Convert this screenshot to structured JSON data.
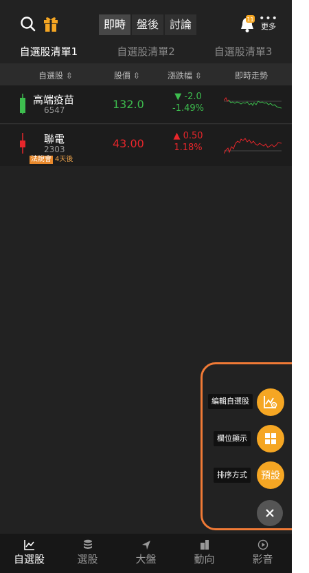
{
  "header": {
    "segments": [
      "即時",
      "盤後",
      "討論"
    ],
    "active_segment": 0,
    "notification_badge": "11",
    "more_label": "更多"
  },
  "list_tabs": [
    "自選股清單1",
    "自選股清單2",
    "自選股清單3"
  ],
  "columns": {
    "stock": "自選股",
    "price": "股價",
    "change": "漲跌幅",
    "trend": "即時走勢"
  },
  "stocks": [
    {
      "name": "高端疫苗",
      "code": "6547",
      "price": "132.0",
      "change": "▼ -2.0",
      "change_pct": "-1.49%",
      "direction": "down",
      "color": "#3dbd4e"
    },
    {
      "name": "聯電",
      "code": "2303",
      "price": "43.00",
      "change": "▲ 0.50",
      "change_pct": "1.18%",
      "direction": "up",
      "color": "#e8262b",
      "event_badge": "法說會",
      "event_time": "4天後"
    }
  ],
  "fab_menu": {
    "edit_label": "編輯自選股",
    "fields_label": "欄位顯示",
    "sort_label": "排序方式",
    "sort_button": "預設",
    "accent": "#f5a623",
    "outline": "#f07a36"
  },
  "bottom_nav": [
    {
      "label": "自選股",
      "icon": "chart-line-icon"
    },
    {
      "label": "選股",
      "icon": "database-icon"
    },
    {
      "label": "大盤",
      "icon": "navigation-arrow-icon"
    },
    {
      "label": "動向",
      "icon": "building-icon"
    },
    {
      "label": "影音",
      "icon": "play-circle-icon"
    }
  ]
}
